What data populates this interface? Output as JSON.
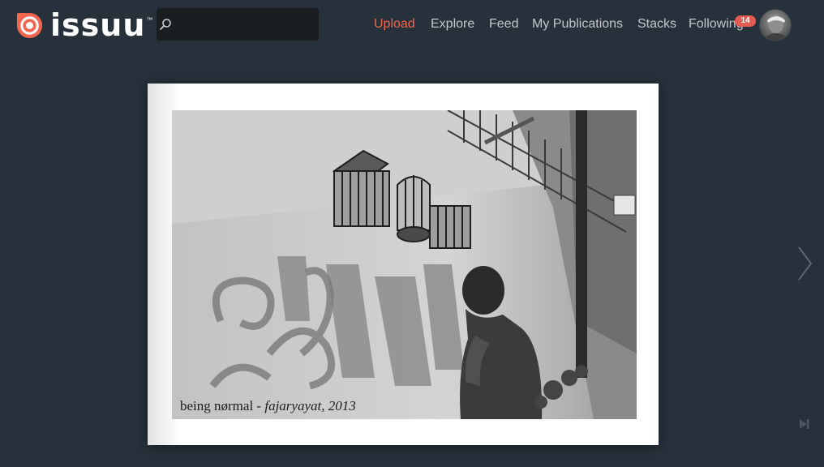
{
  "header": {
    "logo_text": "issuu",
    "logo_tm": "™",
    "search": {
      "value": "",
      "placeholder": ""
    },
    "nav": [
      {
        "label": "Upload",
        "active": true
      },
      {
        "label": "Explore",
        "active": false
      },
      {
        "label": "Feed",
        "active": false
      },
      {
        "label": "My Publications",
        "active": false
      },
      {
        "label": "Stacks",
        "active": false
      },
      {
        "label": "Following",
        "active": false
      }
    ],
    "following_badge": "14",
    "accent_color": "#f26650",
    "icons": [
      "issuu-logo-icon",
      "search-icon",
      "avatar"
    ]
  },
  "viewer": {
    "caption_title": "being nørmal - ",
    "caption_credit": "fajaryayat, 2013",
    "icons": [
      "chevron-right-icon",
      "last-page-icon"
    ]
  }
}
